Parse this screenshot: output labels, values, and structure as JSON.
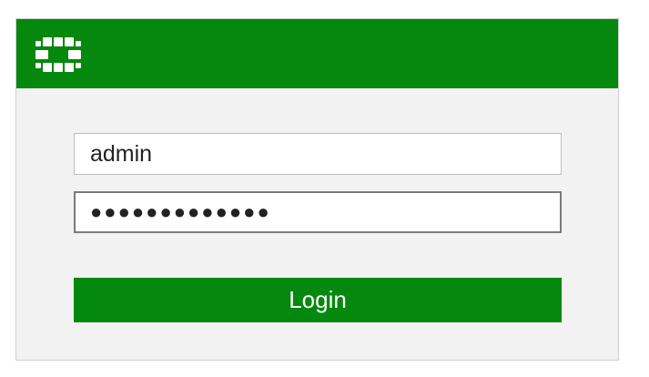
{
  "header": {
    "logo_icon": "fortinet-logo-icon",
    "background_color": "#05880e"
  },
  "form": {
    "username_value": "admin",
    "password_value": "●●●●●●●●●●●●●",
    "login_label": "Login",
    "accent_color": "#05880e"
  }
}
